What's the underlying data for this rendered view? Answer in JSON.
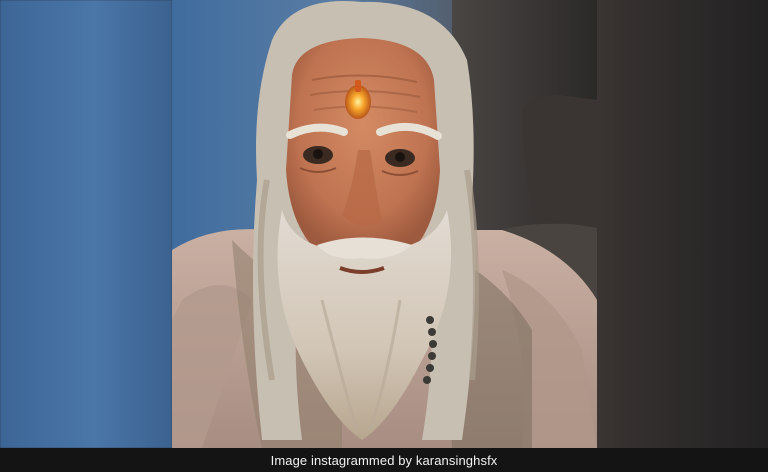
{
  "image": {
    "subject": "elderly sadhu-style character portrait",
    "colors": {
      "background_blue": "#4a76a8",
      "background_dark": "#2d2a2a",
      "skin": "#c9805e",
      "hair_beard": "#d8cfc2",
      "robe": "#bda497",
      "caption_bar": "#141414",
      "caption_text": "#f2f2f2"
    }
  },
  "caption": {
    "text": "Image instagrammed by karansinghsfx"
  }
}
